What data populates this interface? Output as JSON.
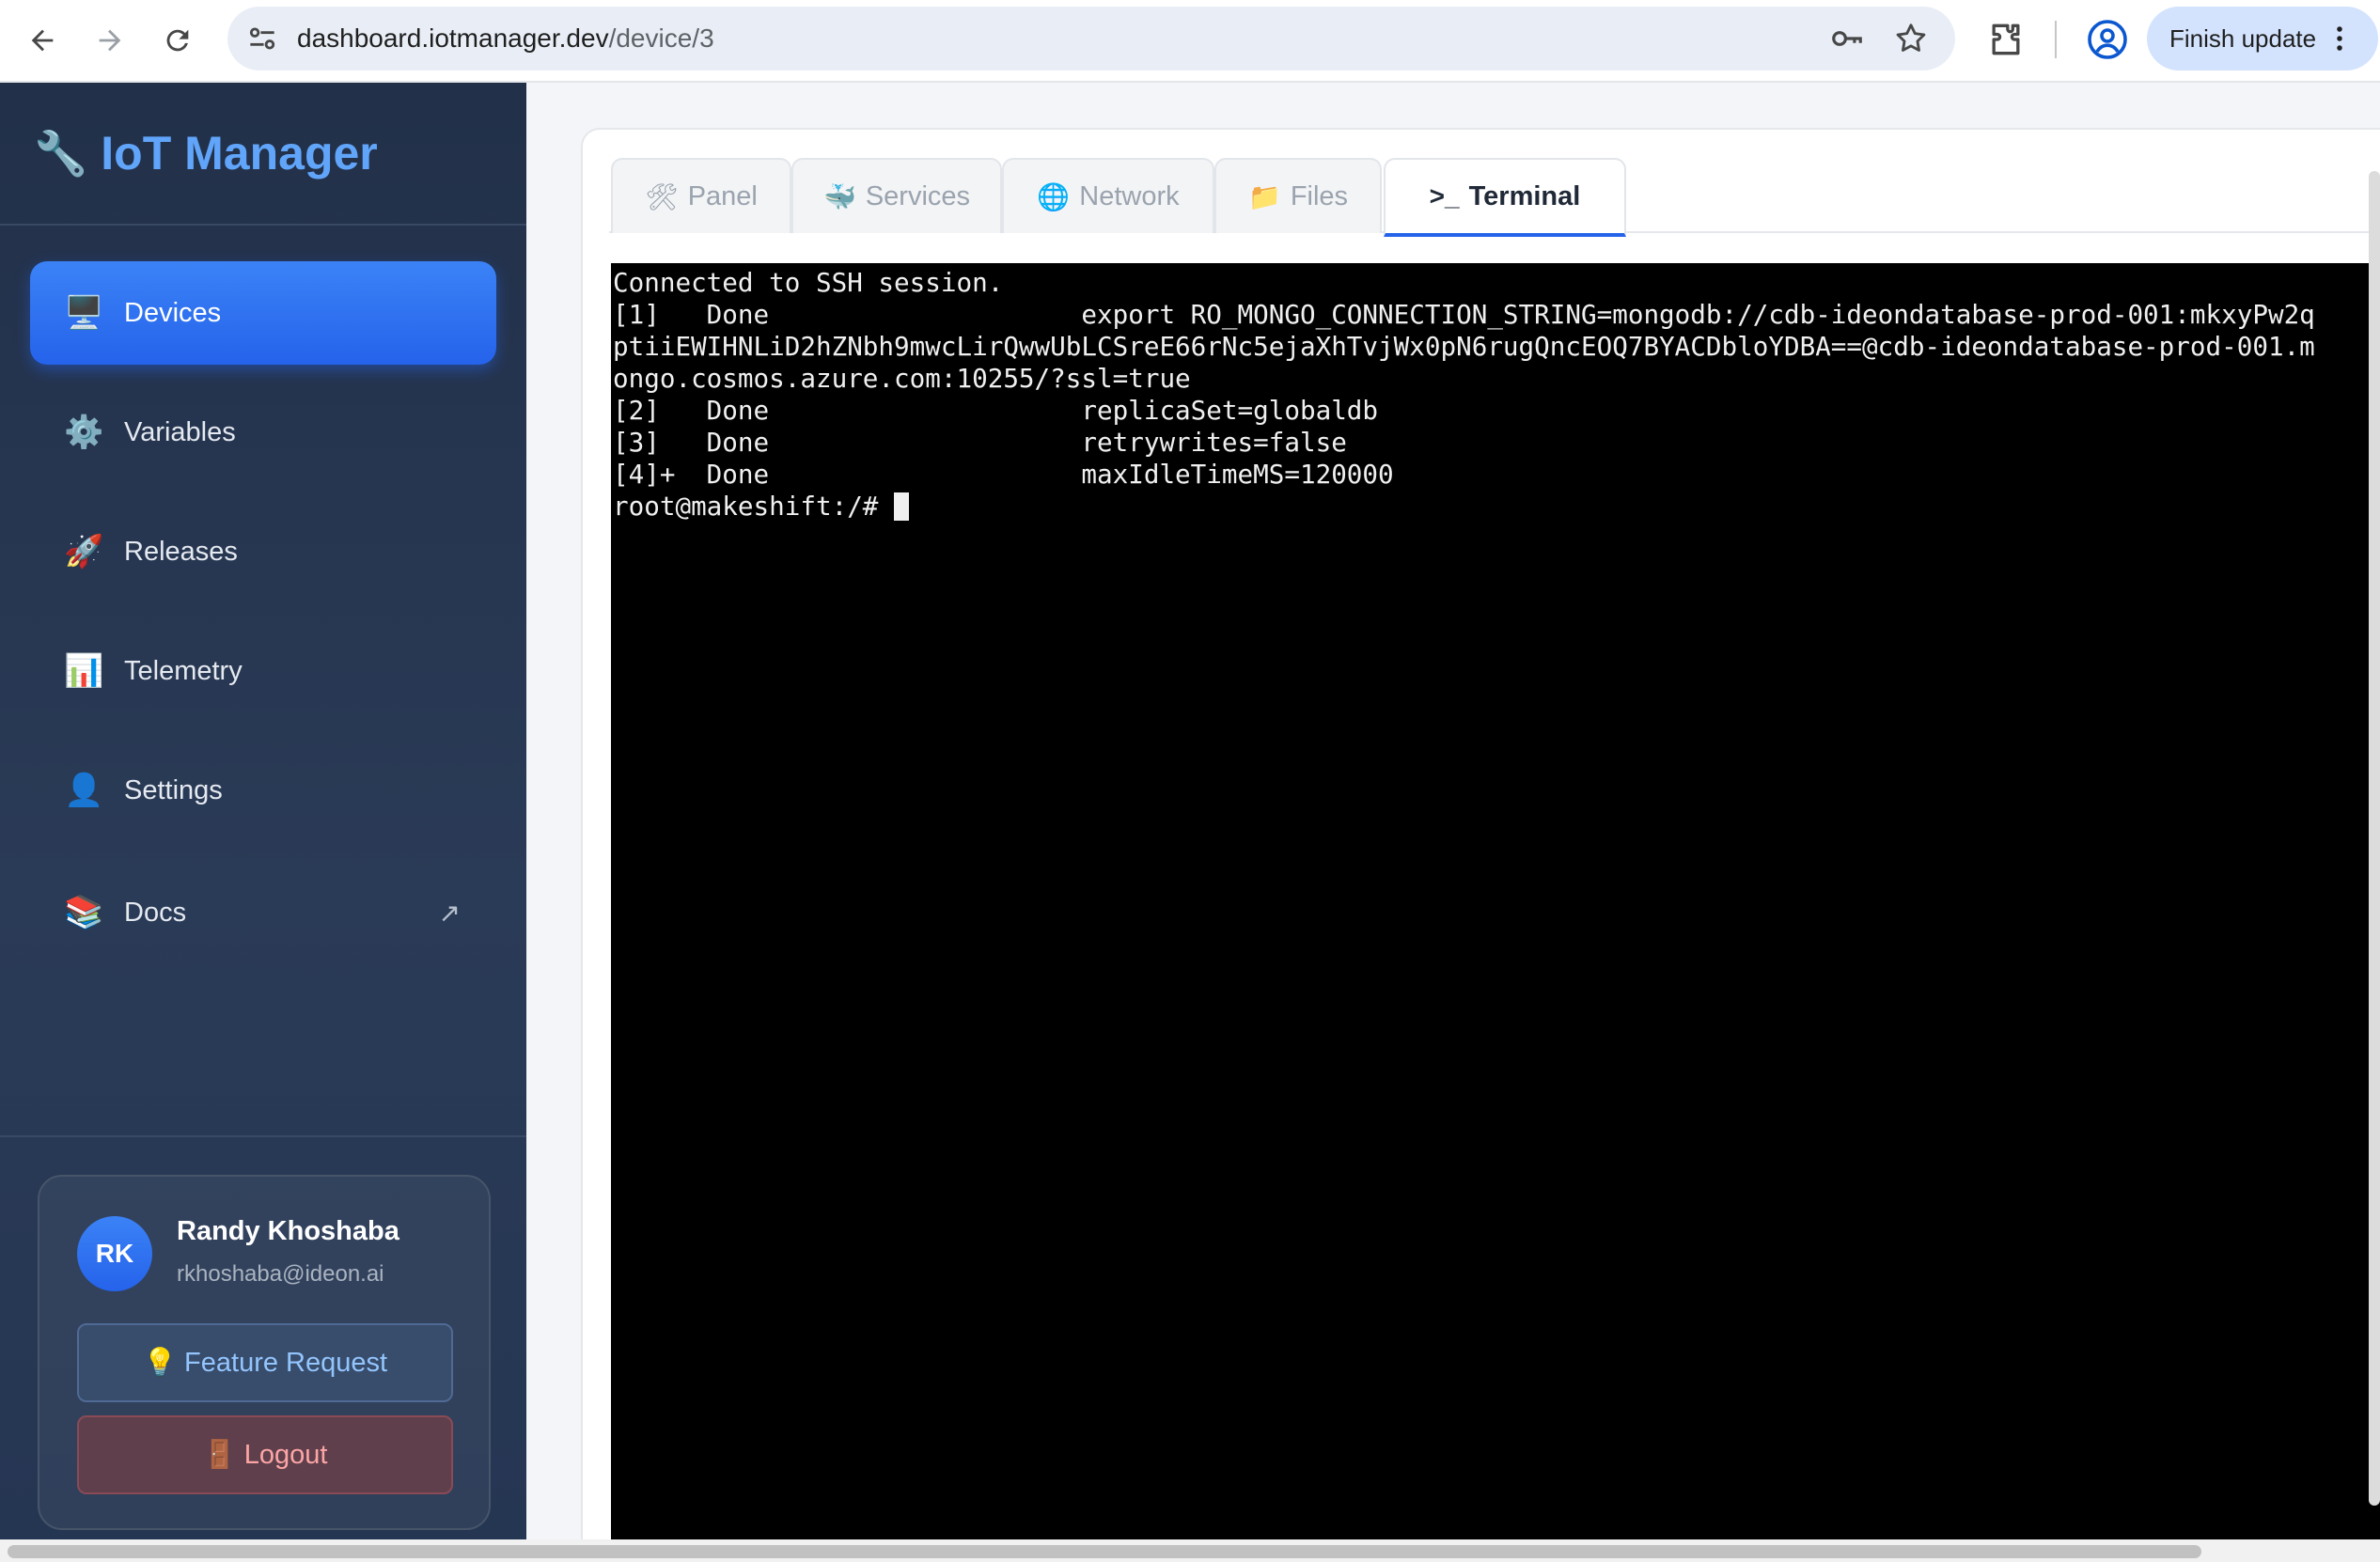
{
  "browser": {
    "url_host": "dashboard.iotmanager.dev",
    "url_path": "/device/3",
    "finish_update_label": "Finish update"
  },
  "sidebar": {
    "brand": {
      "icon": "🔧",
      "name": "IoT Manager"
    },
    "items": [
      {
        "icon": "🖥️",
        "icon_name": "monitor-icon",
        "label": "Devices",
        "active": true
      },
      {
        "icon": "⚙️",
        "icon_name": "gear-icon",
        "label": "Variables"
      },
      {
        "icon": "🚀",
        "icon_name": "rocket-icon",
        "label": "Releases"
      },
      {
        "icon": "📊",
        "icon_name": "bar-chart-icon",
        "label": "Telemetry"
      },
      {
        "icon": "👤",
        "icon_name": "person-icon",
        "label": "Settings"
      },
      {
        "icon": "📚",
        "icon_name": "books-icon",
        "label": "Docs",
        "external_icon": "↗"
      }
    ],
    "user": {
      "initials": "RK",
      "name": "Randy Khoshaba",
      "email": "rkhoshaba@ideon.ai",
      "feature_request_icon": "💡",
      "feature_request_label": "Feature Request",
      "logout_icon": "🚪",
      "logout_label": "Logout"
    }
  },
  "tabs": [
    {
      "icon": "🛠",
      "icon_name": "tools-icon",
      "label": "Panel"
    },
    {
      "icon": "🐳",
      "icon_name": "whale-icon",
      "label": "Services"
    },
    {
      "icon": "🌐",
      "icon_name": "globe-icon",
      "label": "Network"
    },
    {
      "icon": "📁",
      "icon_name": "folder-icon",
      "label": "Files"
    },
    {
      "icon": ">_",
      "icon_name": "terminal-icon",
      "label": "Terminal",
      "active": true
    }
  ],
  "terminal": {
    "lines": [
      "Connected to SSH session.",
      "[1]   Done                    export RO_MONGO_CONNECTION_STRING=mongodb://cdb-ideondatabase-prod-001:mkxyPw2q",
      "ptiiEWIHNLiD2hZNbh9mwcLirQwwUbLCSreE66rNc5ejaXhTvjWx0pN6rugQncEOQ7BYACDbloYDBA==@cdb-ideondatabase-prod-001.m",
      "ongo.cosmos.azure.com:10255/?ssl=true",
      "[2]   Done                    replicaSet=globaldb",
      "[3]   Done                    retrywrites=false",
      "[4]+  Done                    maxIdleTimeMS=120000"
    ],
    "prompt": "root@makeshift:/# "
  }
}
